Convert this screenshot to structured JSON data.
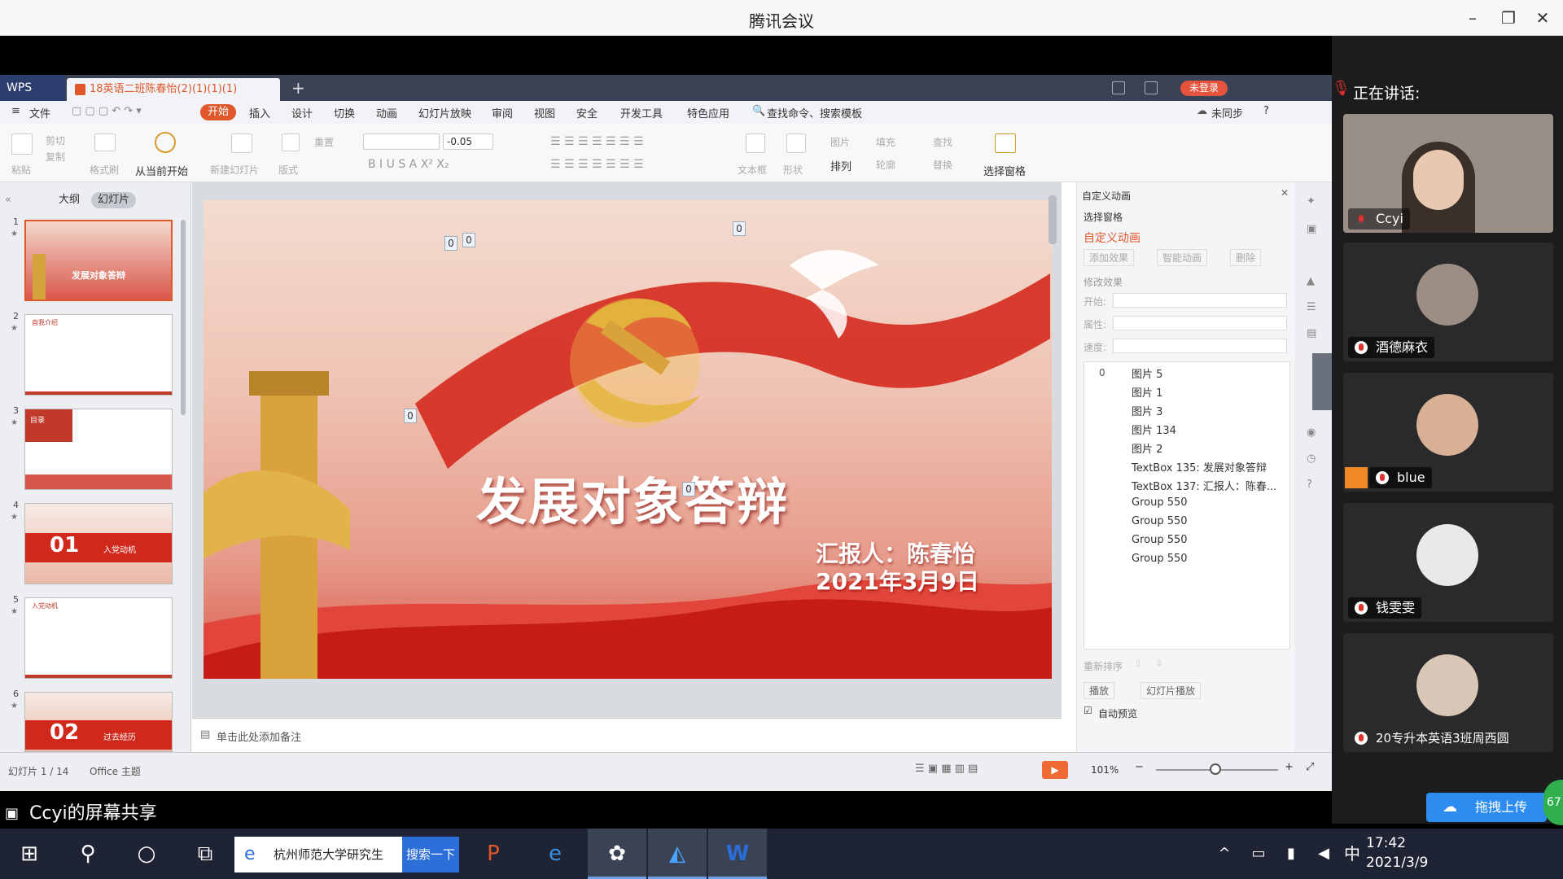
{
  "window": {
    "title": "腾讯会议"
  },
  "wps": {
    "logo": "WPS",
    "doc_tab": "18英语二班陈春怡(2)(1)(1)(1)",
    "not_logged_in": "未登录",
    "menus": [
      "文件",
      "开始",
      "插入",
      "设计",
      "切换",
      "动画",
      "幻灯片放映",
      "审阅",
      "视图",
      "安全",
      "开发工具",
      "特色应用"
    ],
    "active_menu": "开始",
    "search_placeholder": "查找命令、搜索模板",
    "sync": "未同步",
    "ribbon": {
      "paste": "粘贴",
      "cut": "剪切",
      "copy": "复制",
      "format_painter": "格式刷",
      "play_from_current": "从当前开始",
      "new_slide": "新建幻灯片",
      "layout": "版式",
      "reset": "重置",
      "font_size": "-0.05",
      "textbox": "文本框",
      "shape": "形状",
      "picture": "图片",
      "fill": "填充",
      "find": "查找",
      "replace": "替换",
      "arrange": "排列",
      "outline_shape": "轮廓",
      "select_pane": "选择窗格"
    },
    "left_tabs": {
      "outline": "大纲",
      "slides": "幻灯片"
    },
    "slides": [
      {
        "num": "1",
        "title": "发展对象答辩"
      },
      {
        "num": "2",
        "title": "自我介绍"
      },
      {
        "num": "3",
        "title": "目录"
      },
      {
        "num": "4",
        "big": "01",
        "title": "入党动机"
      },
      {
        "num": "5",
        "title": "入党动机"
      },
      {
        "num": "6",
        "big": "02",
        "title": "过去经历"
      }
    ],
    "slide": {
      "title": "发展对象答辩",
      "reporter": "汇报人：陈春怡",
      "date": "2021年3月9日",
      "tags": [
        "0",
        "0",
        "0",
        "0",
        "0"
      ]
    },
    "notes": "单击此处添加备注",
    "anim": {
      "header": "自定义动画",
      "select_pane": "选择窗格",
      "title": "自定义动画",
      "add_effect": "添加效果",
      "smart_anim": "智能动画",
      "delete": "删除",
      "modify": "修改效果",
      "start": "开始:",
      "property": "属性:",
      "speed": "速度:",
      "items": [
        {
          "num": "0",
          "name": "图片 5"
        },
        {
          "num": "",
          "name": "图片 1"
        },
        {
          "num": "",
          "name": "图片 3"
        },
        {
          "num": "",
          "name": "图片 134"
        },
        {
          "num": "",
          "name": "图片 2"
        },
        {
          "num": "",
          "name": "TextBox 135: 发展对象答辩"
        },
        {
          "num": "",
          "name": "TextBox 137: 汇报人：陈春..."
        },
        {
          "num": "",
          "name": "Group 550"
        },
        {
          "num": "",
          "name": "Group 550"
        },
        {
          "num": "",
          "name": "Group 550"
        },
        {
          "num": "",
          "name": "Group 550"
        }
      ],
      "reorder": "重新排序",
      "play": "播放",
      "slideshow": "幻灯片播放",
      "autopreview": "自动预览"
    },
    "status": {
      "slide_count": "幻灯片 1 / 14",
      "theme": "Office 主题",
      "zoom": "101%"
    }
  },
  "meeting": {
    "speaking_label": "正在讲话:",
    "participants": [
      {
        "name": "Ccyi"
      },
      {
        "name": "酒德麻衣"
      },
      {
        "name": "blue"
      },
      {
        "name": "钱雯雯"
      },
      {
        "name": "20专升本英语3班周西圆"
      }
    ],
    "share_label": "Ccyi的屏幕共享",
    "upload": "拖拽上传",
    "badge": "67"
  },
  "taskbar": {
    "search_text": "杭州师范大学研究生",
    "search_btn": "搜索一下",
    "time": "17:42",
    "date": "2021/3/9",
    "ime": "中"
  }
}
